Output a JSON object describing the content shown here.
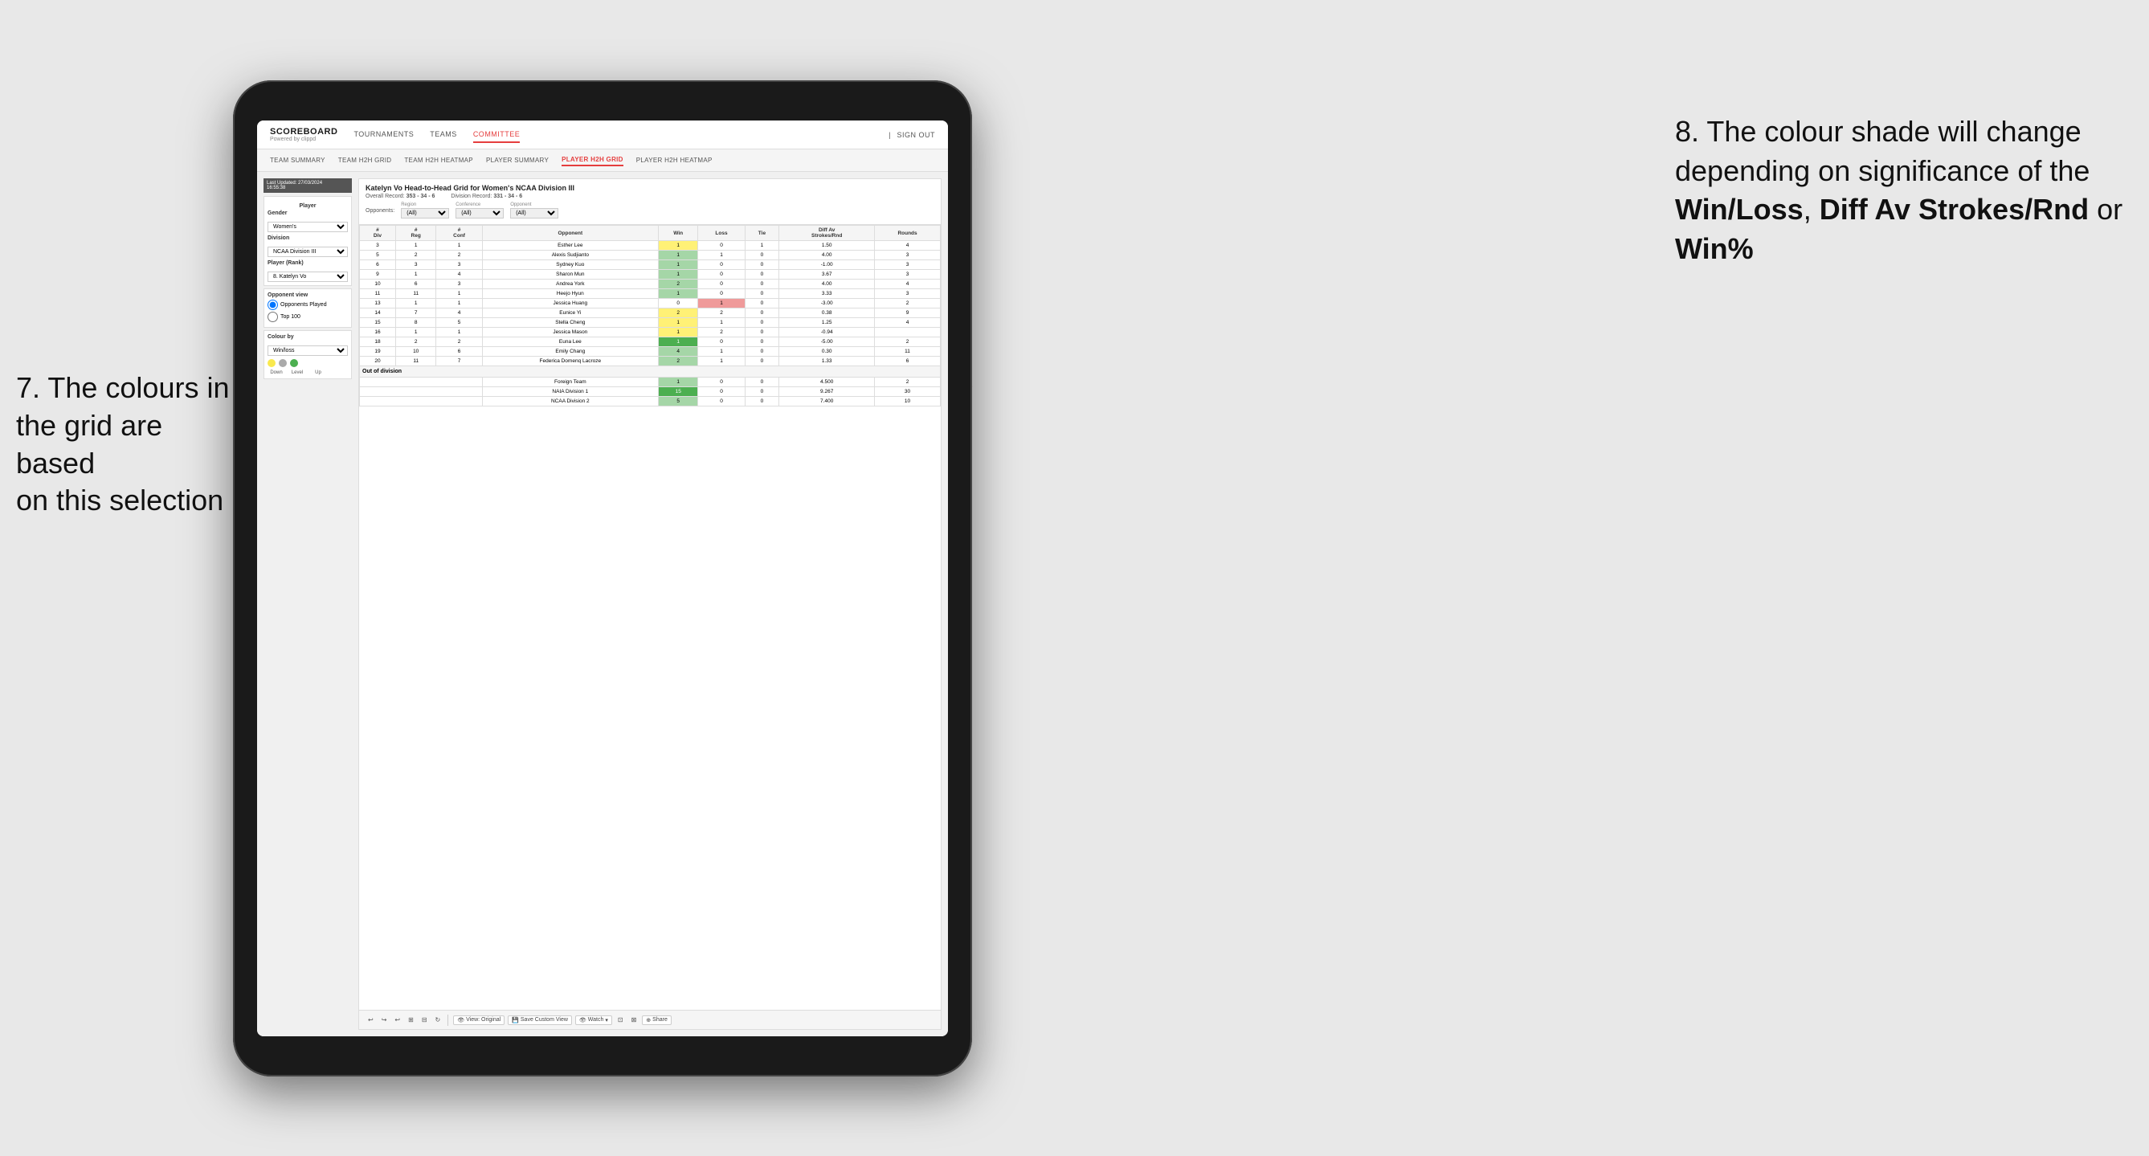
{
  "annotations": {
    "left": {
      "line1": "7. The colours in",
      "line2": "the grid are based",
      "line3": "on this selection"
    },
    "right": {
      "intro": "8. The colour shade will change depending on significance of the ",
      "bold1": "Win/Loss",
      "comma": ", ",
      "bold2": "Diff Av Strokes/Rnd",
      "or": " or ",
      "bold3": "Win%"
    }
  },
  "nav": {
    "logo": "SCOREBOARD",
    "logo_sub": "Powered by clippd",
    "items": [
      "TOURNAMENTS",
      "TEAMS",
      "COMMITTEE"
    ],
    "active": "COMMITTEE",
    "sign_in": "Sign out"
  },
  "sub_nav": {
    "items": [
      "TEAM SUMMARY",
      "TEAM H2H GRID",
      "TEAM H2H HEATMAP",
      "PLAYER SUMMARY",
      "PLAYER H2H GRID",
      "PLAYER H2H HEATMAP"
    ],
    "active": "PLAYER H2H GRID"
  },
  "left_panel": {
    "last_updated_label": "Last Updated: 27/03/2024",
    "last_updated_time": "16:55:38",
    "player_section": "Player",
    "gender_label": "Gender",
    "gender_value": "Women's",
    "division_label": "Division",
    "division_value": "NCAA Division III",
    "player_rank_label": "Player (Rank)",
    "player_rank_value": "8. Katelyn Vo",
    "opponent_view_label": "Opponent view",
    "opponents_played_label": "Opponents Played",
    "top100_label": "Top 100",
    "colour_by_label": "Colour by",
    "colour_by_value": "Win/loss",
    "legend": {
      "down_label": "Down",
      "level_label": "Level",
      "up_label": "Up"
    }
  },
  "grid": {
    "title": "Katelyn Vo Head-to-Head Grid for Women's NCAA Division III",
    "overall_record_label": "Overall Record:",
    "overall_record_value": "353 - 34 - 6",
    "division_record_label": "Division Record:",
    "division_record_value": "331 - 34 - 6",
    "opponents_label": "Opponents:",
    "region_label": "Region",
    "conference_label": "Conference",
    "opponent_label": "Opponent",
    "filter_all": "(All)",
    "col_headers": [
      "# Div",
      "# Reg",
      "# Conf",
      "Opponent",
      "Win",
      "Loss",
      "Tie",
      "Diff Av Strokes/Rnd",
      "Rounds"
    ],
    "rows": [
      {
        "div": "3",
        "reg": "1",
        "conf": "1",
        "opponent": "Esther Lee",
        "win": "1",
        "loss": "0",
        "tie": "1",
        "diff": "1.50",
        "rounds": "4",
        "win_color": "yellow",
        "loss_color": "empty"
      },
      {
        "div": "5",
        "reg": "2",
        "conf": "2",
        "opponent": "Alexis Sudjianto",
        "win": "1",
        "loss": "1",
        "tie": "0",
        "diff": "4.00",
        "rounds": "3",
        "win_color": "green_light",
        "loss_color": "empty"
      },
      {
        "div": "6",
        "reg": "3",
        "conf": "3",
        "opponent": "Sydney Kuo",
        "win": "1",
        "loss": "0",
        "tie": "0",
        "diff": "-1.00",
        "rounds": "3",
        "win_color": "green_light",
        "loss_color": "empty"
      },
      {
        "div": "9",
        "reg": "1",
        "conf": "4",
        "opponent": "Sharon Mun",
        "win": "1",
        "loss": "0",
        "tie": "0",
        "diff": "3.67",
        "rounds": "3",
        "win_color": "green_light",
        "loss_color": "empty"
      },
      {
        "div": "10",
        "reg": "6",
        "conf": "3",
        "opponent": "Andrea York",
        "win": "2",
        "loss": "0",
        "tie": "0",
        "diff": "4.00",
        "rounds": "4",
        "win_color": "green_light",
        "loss_color": "empty"
      },
      {
        "div": "11",
        "reg": "11",
        "conf": "1",
        "opponent": "Heejo Hyun",
        "win": "1",
        "loss": "0",
        "tie": "0",
        "diff": "3.33",
        "rounds": "3",
        "win_color": "green_light",
        "loss_color": "empty"
      },
      {
        "div": "13",
        "reg": "1",
        "conf": "1",
        "opponent": "Jessica Huang",
        "win": "0",
        "loss": "1",
        "tie": "0",
        "diff": "-3.00",
        "rounds": "2",
        "win_color": "empty",
        "loss_color": "red_light"
      },
      {
        "div": "14",
        "reg": "7",
        "conf": "4",
        "opponent": "Eunice Yi",
        "win": "2",
        "loss": "2",
        "tie": "0",
        "diff": "0.38",
        "rounds": "9",
        "win_color": "yellow",
        "loss_color": "empty"
      },
      {
        "div": "15",
        "reg": "8",
        "conf": "5",
        "opponent": "Stella Cheng",
        "win": "1",
        "loss": "1",
        "tie": "0",
        "diff": "1.25",
        "rounds": "4",
        "win_color": "yellow",
        "loss_color": "empty"
      },
      {
        "div": "16",
        "reg": "1",
        "conf": "1",
        "opponent": "Jessica Mason",
        "win": "1",
        "loss": "2",
        "tie": "0",
        "diff": "-0.94",
        "rounds": "",
        "win_color": "yellow",
        "loss_color": "empty"
      },
      {
        "div": "18",
        "reg": "2",
        "conf": "2",
        "opponent": "Euna Lee",
        "win": "1",
        "loss": "0",
        "tie": "0",
        "diff": "-5.00",
        "rounds": "2",
        "win_color": "green_dark",
        "loss_color": "empty"
      },
      {
        "div": "19",
        "reg": "10",
        "conf": "6",
        "opponent": "Emily Chang",
        "win": "4",
        "loss": "1",
        "tie": "0",
        "diff": "0.30",
        "rounds": "11",
        "win_color": "green_light",
        "loss_color": "empty"
      },
      {
        "div": "20",
        "reg": "11",
        "conf": "7",
        "opponent": "Federica Domenq Lacroze",
        "win": "2",
        "loss": "1",
        "tie": "0",
        "diff": "1.33",
        "rounds": "6",
        "win_color": "green_light",
        "loss_color": "empty"
      }
    ],
    "out_of_division_label": "Out of division",
    "out_of_division_rows": [
      {
        "opponent": "Foreign Team",
        "win": "1",
        "loss": "0",
        "tie": "0",
        "diff": "4.500",
        "rounds": "2",
        "win_color": "green_light"
      },
      {
        "opponent": "NAIA Division 1",
        "win": "15",
        "loss": "0",
        "tie": "0",
        "diff": "9.267",
        "rounds": "30",
        "win_color": "green_dark"
      },
      {
        "opponent": "NCAA Division 2",
        "win": "5",
        "loss": "0",
        "tie": "0",
        "diff": "7.400",
        "rounds": "10",
        "win_color": "green_light"
      }
    ]
  },
  "toolbar": {
    "view_original": "View: Original",
    "save_custom_view": "Save Custom View",
    "watch": "Watch",
    "share": "Share"
  }
}
